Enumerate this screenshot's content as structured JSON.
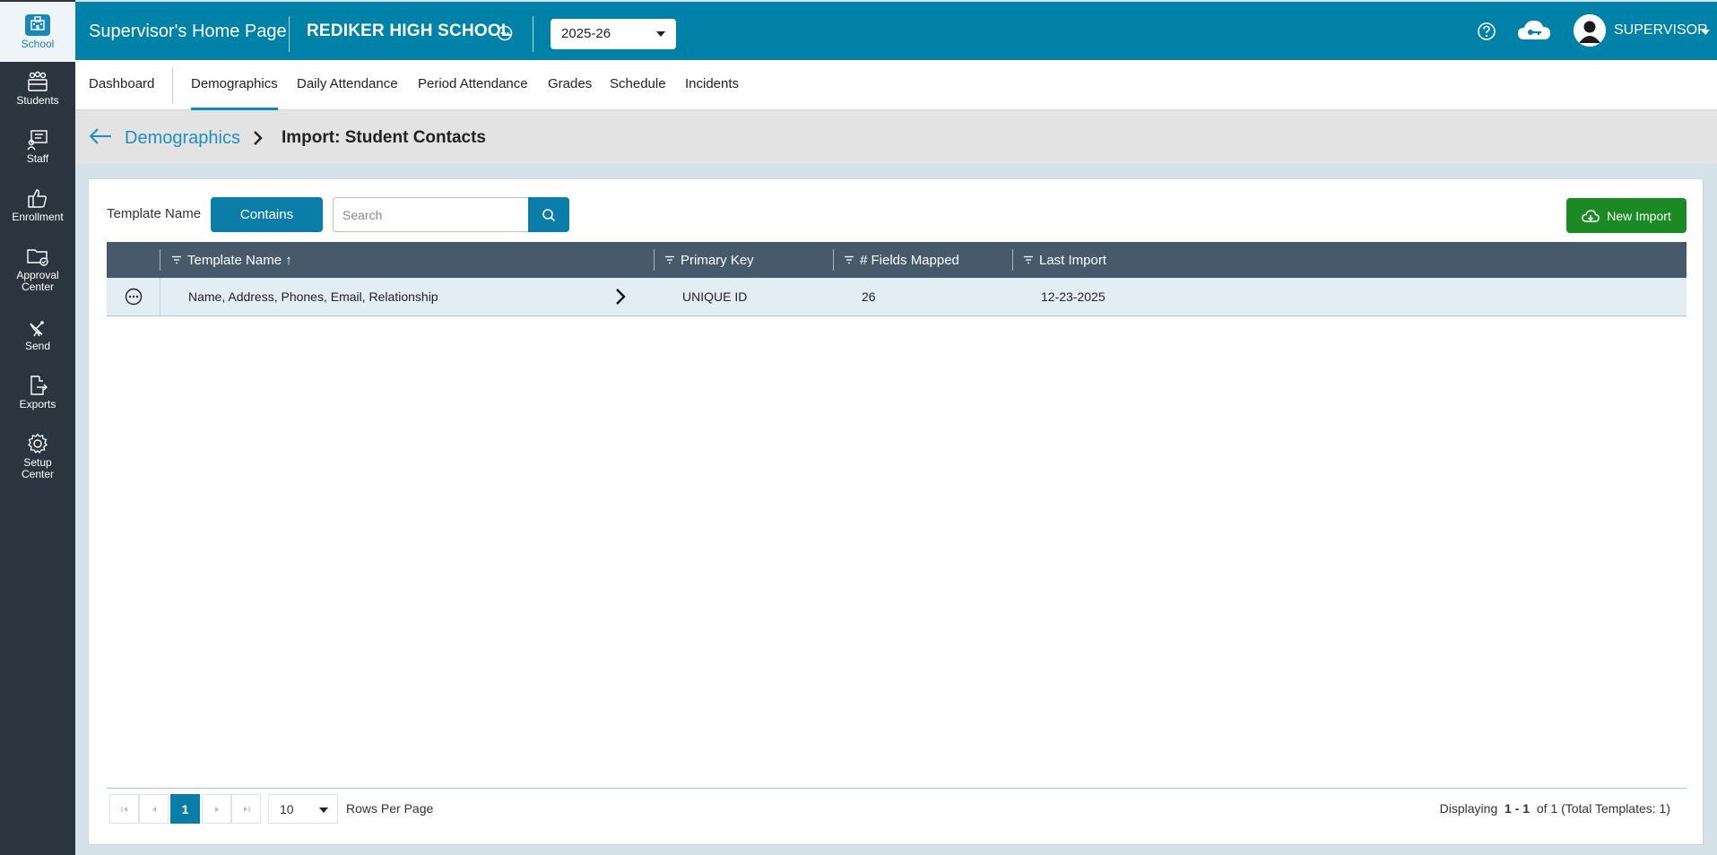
{
  "rail": {
    "items": [
      {
        "label": "School",
        "icon": "school-icon",
        "active": true
      },
      {
        "label": "Students",
        "icon": "students-icon"
      },
      {
        "label": "Staff",
        "icon": "staff-icon"
      },
      {
        "label": "Enrollment",
        "icon": "thumbs-up-icon"
      },
      {
        "label": "Approval",
        "label2": "Center",
        "icon": "folder-check-icon"
      },
      {
        "label": "Send",
        "icon": "satellite-icon"
      },
      {
        "label": "Exports",
        "icon": "export-icon"
      },
      {
        "label": "Setup",
        "label2": "Center",
        "icon": "gear-icon"
      }
    ]
  },
  "header": {
    "title": "Supervisor's Home Page",
    "school": "REDIKER HIGH SCHOOL",
    "year": "2025-26",
    "user": "SUPERVISOR"
  },
  "nav": {
    "tabs": [
      "Dashboard",
      "Demographics",
      "Daily Attendance",
      "Period Attendance",
      "Grades",
      "Schedule",
      "Incidents"
    ],
    "active": "Demographics"
  },
  "breadcrumb": {
    "parent": "Demographics",
    "current": "Import: Student Contacts"
  },
  "filter": {
    "label": "Template Name",
    "mode": "Contains",
    "placeholder": "Search",
    "value": ""
  },
  "actions": {
    "new_import": "New Import"
  },
  "grid": {
    "columns": [
      "Template Name ↑",
      "Primary Key",
      "# Fields Mapped",
      "Last Import"
    ],
    "rows": [
      {
        "template_name": "Name, Address, Phones, Email, Relationship",
        "primary_key": "UNIQUE ID",
        "fields_mapped": "26",
        "last_import": "12-23-2025"
      }
    ]
  },
  "pager": {
    "current_page": "1",
    "rows_per_page": "10",
    "rows_label": "Rows Per Page",
    "display_prefix": "Displaying",
    "display_range": "1 - 1",
    "display_of": "of",
    "display_total_pages": "1",
    "display_total": "(Total Templates: 1)"
  },
  "colors": {
    "topbar": "#0082a8",
    "rail": "#2b3540",
    "grid_header": "#465a6c",
    "accent": "#0a7ea8",
    "success": "#1b8a25"
  }
}
